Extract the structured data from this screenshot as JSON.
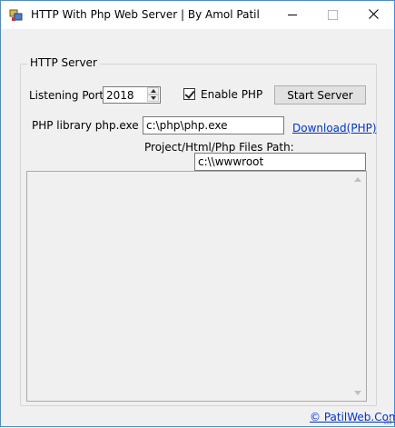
{
  "window": {
    "title": "HTTP With Php Web Server | By Amol Patil",
    "controls": {
      "minimize": "—",
      "maximize": "☐",
      "close": "✕"
    }
  },
  "group": {
    "legend": "HTTP Server"
  },
  "port": {
    "label": "Listening Port :",
    "value": "2018"
  },
  "enable_php": {
    "label": "Enable PHP",
    "checked": true
  },
  "start_button": {
    "label": "Start Server"
  },
  "php_path": {
    "label": "PHP library php.exe Path:",
    "value": "c:\\php\\php.exe"
  },
  "download_link": {
    "label": "Download(PHP)"
  },
  "project_path": {
    "label": "Project/Html/Php Files Path:",
    "value": "c:\\\\wwwroot"
  },
  "log": {
    "text": ""
  },
  "footer": {
    "link": "© PatilWeb.Com"
  },
  "colors": {
    "window_border": "#4a8ad6",
    "link": "#0033cc",
    "face": "#f0f0f0"
  }
}
